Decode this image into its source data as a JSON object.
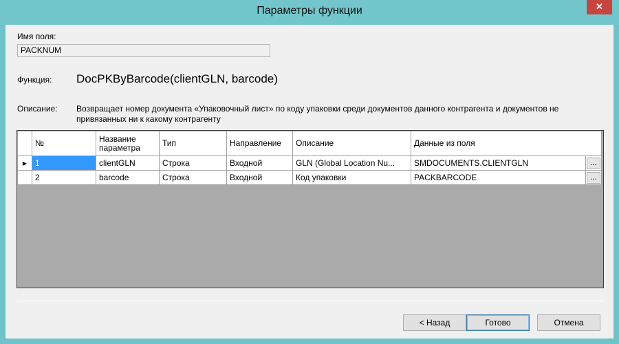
{
  "window": {
    "title": "Параметры функции",
    "close_glyph": "✕"
  },
  "form": {
    "field_label": "Имя поля:",
    "field_value": "PACKNUM",
    "function_label": "Функция:",
    "function_value": "DocPKByBarcode(clientGLN, barcode)",
    "description_label": "Описание:",
    "description_value": "Возвращает номер документа «Упаковочный лист» по коду упаковки среди документов данного контрагента и документов не привязанных ни к какому контрагенту"
  },
  "grid": {
    "columns": [
      "№",
      "Название параметра",
      "Тип",
      "Направление",
      "Описание",
      "Данные из поля"
    ],
    "rows": [
      {
        "num": "1",
        "name": "clientGLN",
        "type": "Строка",
        "direction": "Входной",
        "description": "GLN (Global Location Nu...",
        "data": "SMDOCUMENTS.CLIENTGLN",
        "current_marker": "▶"
      },
      {
        "num": "2",
        "name": "barcode",
        "type": "Строка",
        "direction": "Входной",
        "description": "Код упаковки",
        "data": "PACKBARCODE",
        "current_marker": ""
      }
    ],
    "ellipsis_label": "...",
    "selected_color": "#3399ff"
  },
  "buttons": {
    "back": "< Назад",
    "ok": "Готово",
    "cancel": "Отмена"
  },
  "colors": {
    "titlebar": "#72c6cc",
    "close": "#c7443f",
    "grid_empty": "#aaaaaa"
  }
}
